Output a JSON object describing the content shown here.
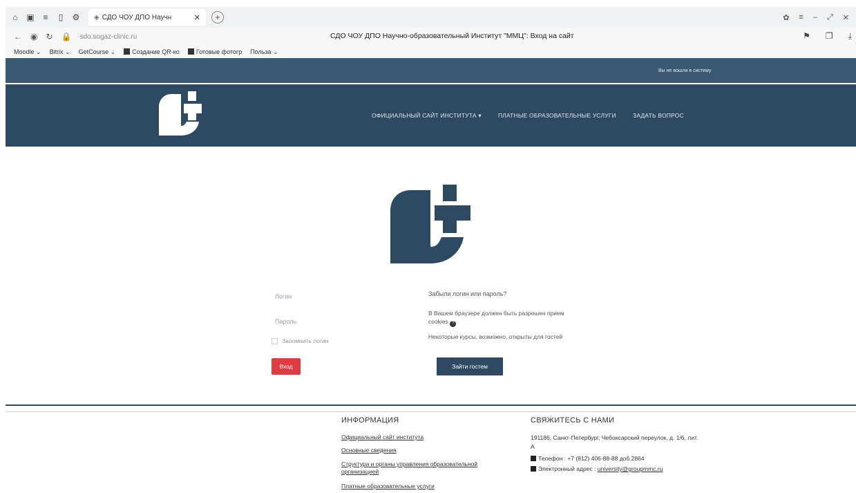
{
  "browser": {
    "tab_title": "СДО ЧОУ ДПО Научн",
    "url": "sdo.sogaz-clinic.ru",
    "page_title": "СДО ЧОУ ДПО Научно-образовательный Институт \"ММЦ\": Вход на сайт",
    "bookmarks": [
      "Moodle ⌄",
      "Bitrix ⌄",
      "GetCourse ⌄",
      "Создание QR-ко",
      "Готовые фотогр",
      "Польза ⌄"
    ]
  },
  "header": {
    "login_status": "Вы не вошли в систему",
    "menu": [
      "Официальный сайт института ▾",
      "Платные образовательные услуги",
      "Задать вопрос"
    ]
  },
  "login": {
    "login_label": "Логин",
    "password_label": "Пароль",
    "remember_label": "Запомнить логин",
    "login_button": "Вход",
    "forgot": "Забыли логин или пароль?",
    "cookies": "В Вашем браузере должен быть разрешен прием cookies",
    "guests": "Некоторые курсы, возможно, открыты для гостей",
    "guest_button": "Зайти гостем"
  },
  "footer": {
    "info_title": "Информация",
    "info_links": [
      "Официальный сайт института",
      "Основные сведения",
      "Структура и органы управления образовательной организацией",
      "Платные образовательные услуги"
    ],
    "contact_title": "Свяжитесь с нами",
    "address": "191186, Санкт-Петербург, Чебоксарский переулок, д. 1/6, лит. А",
    "phone": "Телефон : +7 (812) 406-88-88 доб.2864",
    "email_label": "Электронный адрес : ",
    "email": "university@groupmmc.ru"
  },
  "colors": {
    "brand_dark": "#2e4a63",
    "login_button": "#e03a43"
  }
}
